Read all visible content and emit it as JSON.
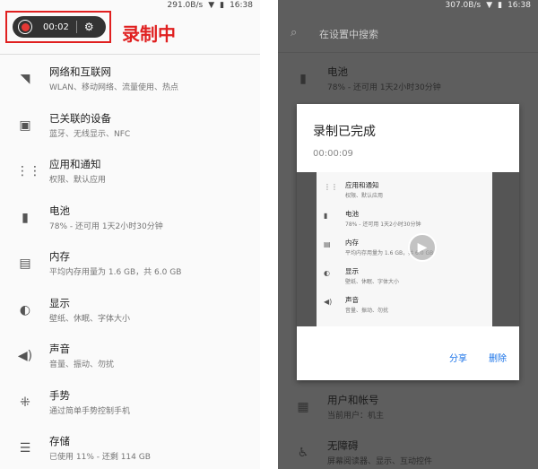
{
  "left": {
    "status": {
      "speed": "291.0B/s",
      "time": "16:38"
    },
    "recorder": {
      "time": "00:02",
      "label": "录制中"
    },
    "items": [
      {
        "title": "网络和互联网",
        "sub": "WLAN、移动网络、流量使用、热点",
        "icon": "wifi-icon"
      },
      {
        "title": "已关联的设备",
        "sub": "蓝牙、无线显示、NFC",
        "icon": "devices-icon"
      },
      {
        "title": "应用和通知",
        "sub": "权限、默认应用",
        "icon": "apps-icon"
      },
      {
        "title": "电池",
        "sub": "78% - 还可用 1天2小时30分钟",
        "icon": "battery-icon"
      },
      {
        "title": "内存",
        "sub": "平均内存用量为 1.6 GB，共 6.0 GB",
        "icon": "memory-icon"
      },
      {
        "title": "显示",
        "sub": "壁纸、休眠、字体大小",
        "icon": "display-icon"
      },
      {
        "title": "声音",
        "sub": "音量、振动、勿扰",
        "icon": "sound-icon"
      },
      {
        "title": "手势",
        "sub": "通过简单手势控制手机",
        "icon": "gesture-icon"
      },
      {
        "title": "存储",
        "sub": "已使用 11% - 还剩 114 GB",
        "icon": "storage-icon"
      }
    ]
  },
  "right": {
    "status": {
      "speed": "307.0B/s",
      "time": "16:38"
    },
    "search_placeholder": "在设置中搜索",
    "items": [
      {
        "title": "电池",
        "sub": "78% - 还可用 1天2小时30分钟"
      },
      {
        "title": "用户和帐号",
        "sub": "当前用户：机主"
      },
      {
        "title": "无障碍",
        "sub": "屏幕阅读器、显示、互动控件"
      }
    ],
    "dialog": {
      "title": "录制已完成",
      "duration": "00:00:09",
      "share": "分享",
      "delete": "删除",
      "thumb_items": [
        {
          "title": "应用和通知",
          "sub": "权限、默认应用"
        },
        {
          "title": "电池",
          "sub": "78% - 还可用 1天2小时30分钟"
        },
        {
          "title": "内存",
          "sub": "平均内存用量为 1.6 GB，共 6.0 GB"
        },
        {
          "title": "显示",
          "sub": "壁纸、休眠、字体大小"
        },
        {
          "title": "声音",
          "sub": "音量、振动、勿扰"
        }
      ]
    }
  }
}
